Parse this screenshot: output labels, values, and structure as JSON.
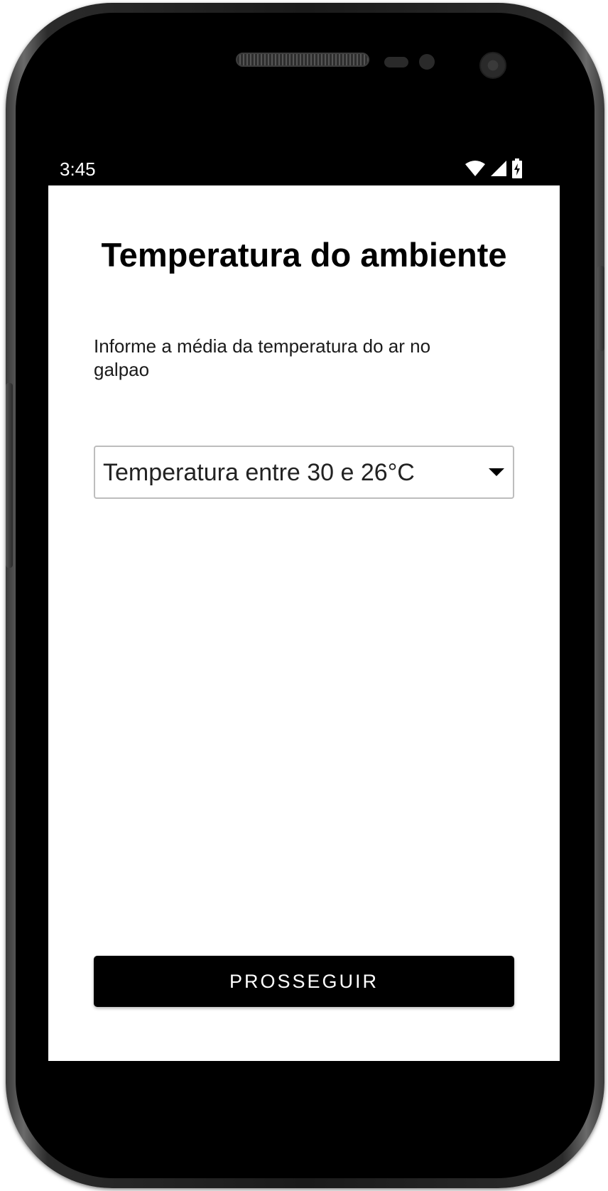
{
  "status_bar": {
    "time": "3:45",
    "icons": [
      "wifi-icon",
      "cellular-signal-icon",
      "battery-charging-icon"
    ]
  },
  "screen": {
    "title": "Temperatura do ambiente",
    "instruction": "Informe a média da temperatura do ar no galpao",
    "temperature_select": {
      "selected_value": "Temperatura entre 30 e 26°C"
    },
    "proceed_button_label": "PROSSEGUIR"
  },
  "colors": {
    "primary_button": "#000000",
    "status_bar": "#000000",
    "background": "#ffffff"
  }
}
